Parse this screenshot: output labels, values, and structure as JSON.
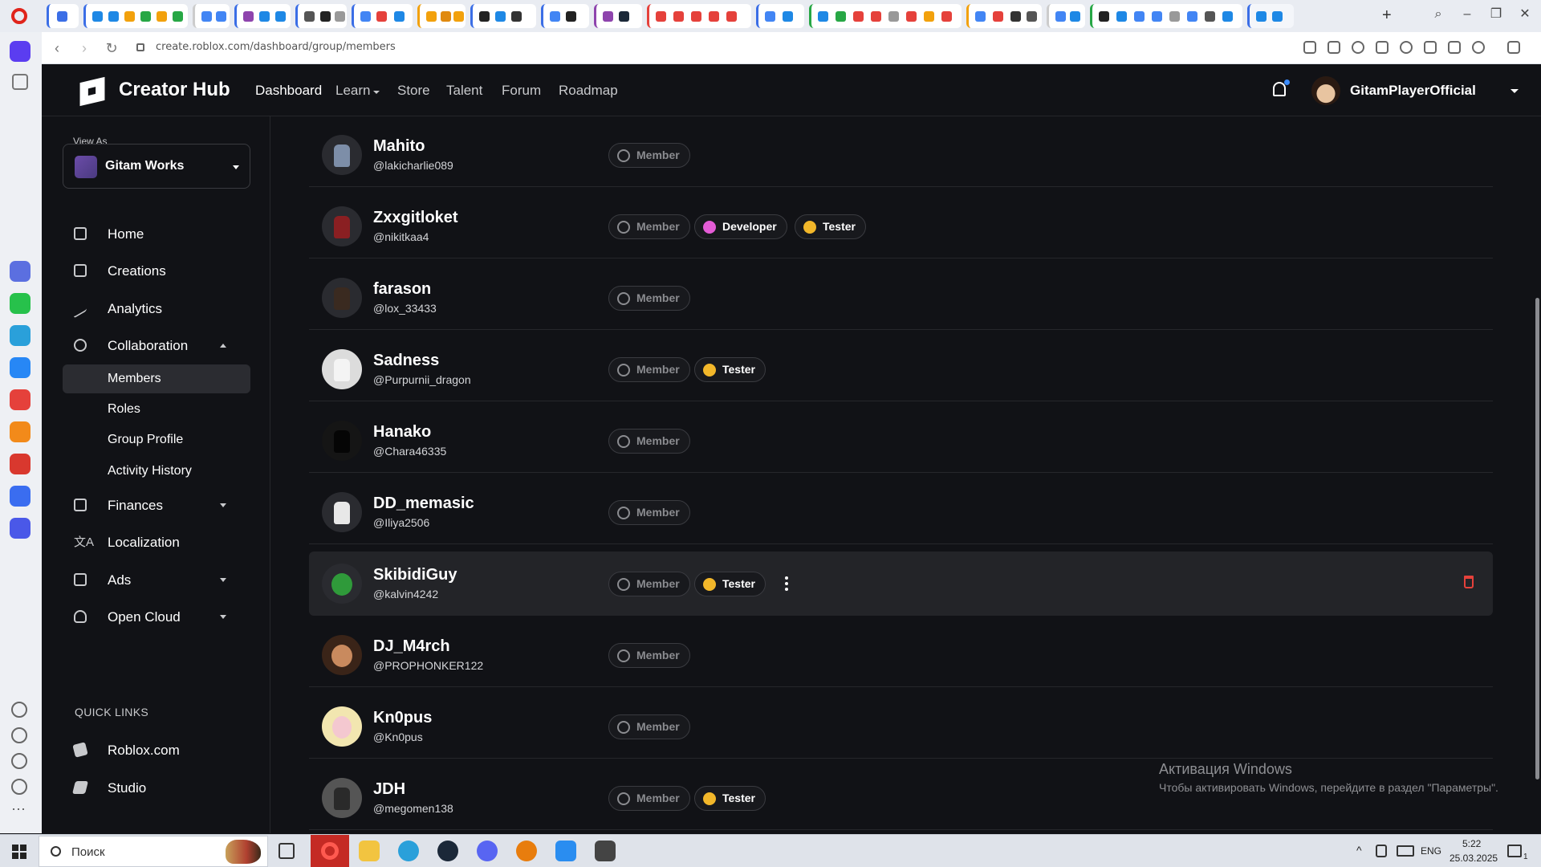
{
  "browser": {
    "url": "create.roblox.com/dashboard/group/members",
    "tab_group_colors": [
      "#3b6ee6",
      "#e0241b",
      "#27a745",
      "#f2a10c",
      "#8e44ad",
      "#e5413b",
      "#1e88e5"
    ]
  },
  "hub": {
    "title": "Creator Hub",
    "nav": [
      "Dashboard",
      "Learn",
      "Store",
      "Talent",
      "Forum",
      "Roadmap"
    ],
    "active_nav": "Dashboard",
    "user": "GitamPlayerOfficial"
  },
  "sidebar": {
    "view_as_label": "View As",
    "view_as_value": "Gitam Works",
    "items": [
      {
        "label": "Home",
        "icon": "home-icon"
      },
      {
        "label": "Creations",
        "icon": "creations-icon"
      },
      {
        "label": "Analytics",
        "icon": "analytics-icon"
      },
      {
        "label": "Collaboration",
        "icon": "collaboration-icon",
        "expanded": true
      },
      {
        "label": "Finances",
        "icon": "finances-icon"
      },
      {
        "label": "Localization",
        "icon": "localization-icon"
      },
      {
        "label": "Ads",
        "icon": "ads-icon"
      },
      {
        "label": "Open Cloud",
        "icon": "cloud-icon"
      }
    ],
    "collaboration_sub": [
      "Members",
      "Roles",
      "Group Profile",
      "Activity History"
    ],
    "active_sub": "Members",
    "quick_links_title": "QUICK LINKS",
    "quick_links": [
      "Roblox.com",
      "Studio"
    ]
  },
  "members": [
    {
      "name": "Mahito",
      "handle": "@lakicharlie089",
      "roles": [
        "Member"
      ]
    },
    {
      "name": "Zxxgitloket",
      "handle": "@nikitkaa4",
      "roles": [
        "Member",
        "Developer",
        "Tester"
      ]
    },
    {
      "name": "farason",
      "handle": "@lox_33433",
      "roles": [
        "Member"
      ]
    },
    {
      "name": "Sadness",
      "handle": "@Purpurnii_dragon",
      "roles": [
        "Member",
        "Tester"
      ]
    },
    {
      "name": "Hanako",
      "handle": "@Chara46335",
      "roles": [
        "Member"
      ]
    },
    {
      "name": "DD_memasic",
      "handle": "@Iliya2506",
      "roles": [
        "Member"
      ]
    },
    {
      "name": "SkibidiGuy",
      "handle": "@kalvin4242",
      "roles": [
        "Member",
        "Tester"
      ],
      "hovered": true
    },
    {
      "name": "DJ_M4rch",
      "handle": "@PROPHONKER122",
      "roles": [
        "Member"
      ]
    },
    {
      "name": "Kn0pus",
      "handle": "@Kn0pus",
      "roles": [
        "Member"
      ]
    },
    {
      "name": "JDH",
      "handle": "@megomen138",
      "roles": [
        "Member",
        "Tester"
      ]
    }
  ],
  "role_colors": {
    "Member": "#8b8c90",
    "Developer": "#e45cd6",
    "Tester": "#f2b72a"
  },
  "windows_watermark": {
    "title": "Активация Windows",
    "subtitle": "Чтобы активировать Windows, перейдите в раздел \"Параметры\"."
  },
  "taskbar": {
    "search_placeholder": "Поиск",
    "lang": "ENG",
    "time": "5:22",
    "date": "25.03.2025",
    "notification_count": "1"
  }
}
